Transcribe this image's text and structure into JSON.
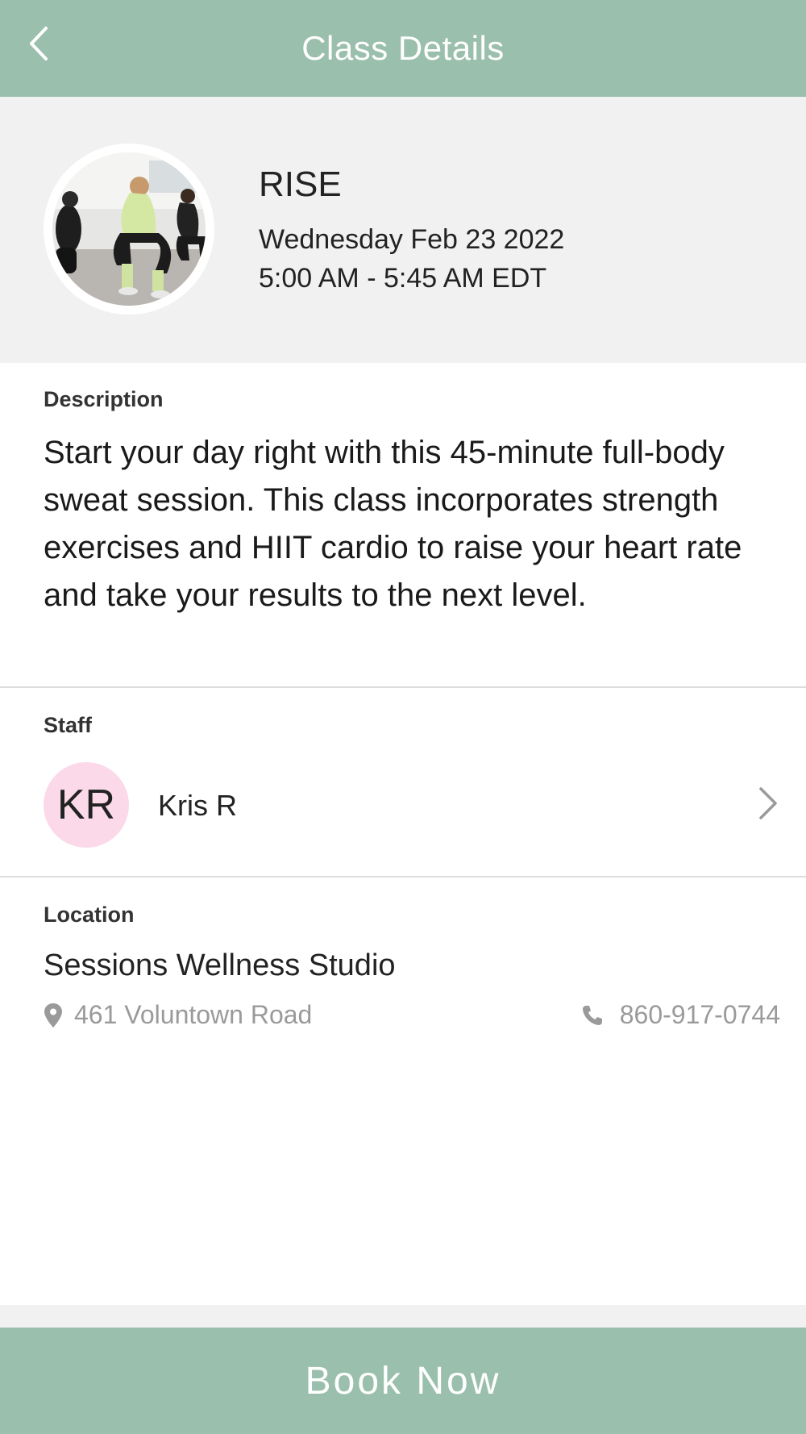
{
  "header": {
    "title": "Class Details",
    "back_icon": "chevron-left-icon",
    "background": "#9abfac"
  },
  "class": {
    "name": "RISE",
    "date": "Wednesday Feb 23 2022",
    "time": "5:00 AM - 5:45 AM EDT",
    "photo": "class-photo"
  },
  "description": {
    "label": "Description",
    "text": "Start your day right with this 45-minute full-body sweat session. This class incorporates strength exercises and HIIT cardio to raise your heart rate and take your results to the next level."
  },
  "staff": {
    "label": "Staff",
    "initials": "KR",
    "name": "Kris R",
    "avatar_color": "#fbd9e8"
  },
  "location": {
    "label": "Location",
    "name": "Sessions Wellness Studio",
    "address": "461 Voluntown Road",
    "phone": "860-917-0744"
  },
  "footer": {
    "book_label": "Book Now"
  }
}
